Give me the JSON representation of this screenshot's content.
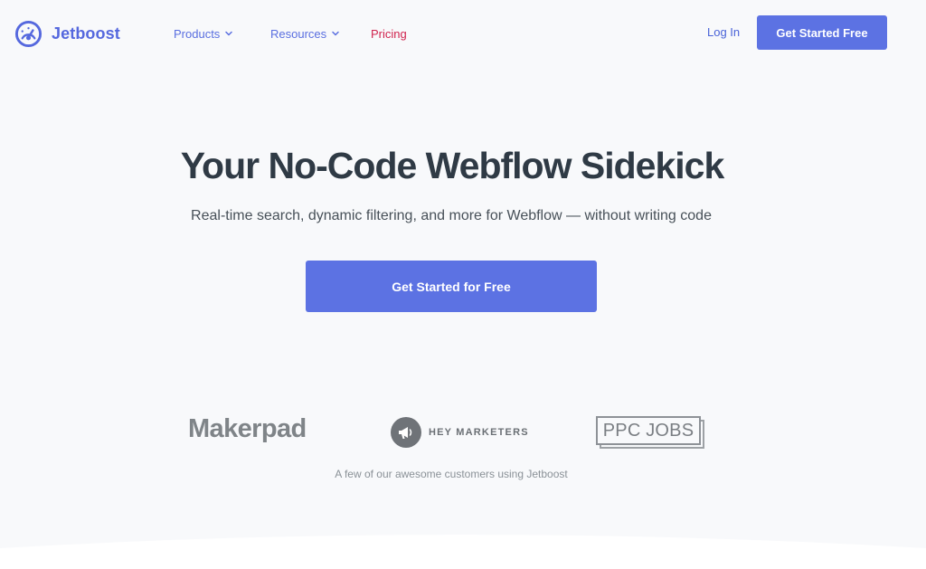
{
  "brand": {
    "name": "Jetboost",
    "icon": "speedometer-icon"
  },
  "nav": {
    "products": "Products",
    "resources": "Resources",
    "pricing": "Pricing",
    "login": "Log In",
    "cta": "Get Started Free"
  },
  "hero": {
    "title": "Your No-Code Webflow Sidekick",
    "subtitle": "Real-time search, dynamic filtering, and more for Webflow — without writing code",
    "cta": "Get Started for Free"
  },
  "customers": {
    "logos": [
      "Makerpad",
      "HEY MARKETERS",
      "PPC JOBS"
    ],
    "caption": "A few of our awesome customers using Jetboost"
  },
  "colors": {
    "accent": "#5c72e3",
    "pricing": "#d0234e",
    "heading": "#2f3a45",
    "background": "#f8f9fb"
  }
}
